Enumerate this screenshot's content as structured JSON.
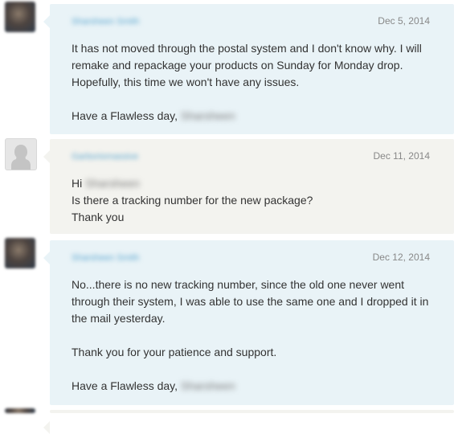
{
  "messages": [
    {
      "sender": "Sharsheen Smith",
      "date": "Dec 5, 2014",
      "lines": [
        "It has not moved through the postal system and I don't know why. I will remake and repackage your products on Sunday for Monday drop. Hopefully, this time we won't have any issues."
      ],
      "signoff": "Have a Flawless day,",
      "signoff_name": "Sharsheen"
    },
    {
      "sender": "Garboriomassive",
      "date": "Dec 11, 2014",
      "greeting": "Hi",
      "greeting_name": "Sharsheen",
      "lines": [
        "Is there a tracking number for the new package?",
        "Thank you"
      ]
    },
    {
      "sender": "Sharsheen Smith",
      "date": "Dec 12, 2014",
      "lines": [
        "No...there is no new tracking number, since the old one never went through their system, I was able to use the same one and I dropped it in the mail yesterday.",
        "Thank you for your patience and support."
      ],
      "signoff": "Have a Flawless day,",
      "signoff_name": "Sharsheen"
    }
  ],
  "icons": {
    "default_avatar": "person-silhouette-icon"
  },
  "colors": {
    "seller_bubble": "#e9f3f7",
    "buyer_bubble": "#f3f3ef",
    "sender_link": "#5ba6cf",
    "date_text": "#888888"
  }
}
